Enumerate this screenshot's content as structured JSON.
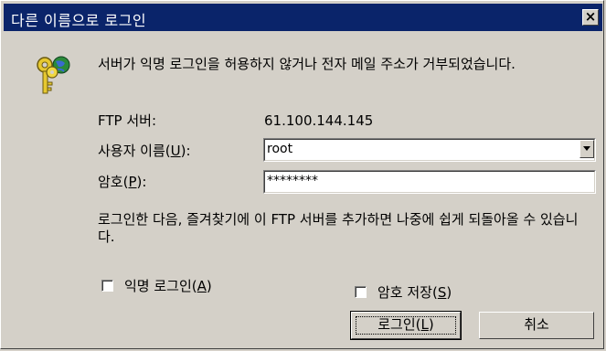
{
  "window": {
    "title": "다른 이름으로 로그인",
    "close_glyph": "×"
  },
  "message": "서버가 익명 로그인을 허용하지 않거나 전자 메일 주소가 거부되었습니다.",
  "ftp_server": {
    "label": "FTP 서버:",
    "value": "61.100.144.145"
  },
  "username": {
    "label_prefix": "사용자 이름(",
    "label_key": "U",
    "label_suffix": "):",
    "value": "root"
  },
  "password": {
    "label_prefix": "암호(",
    "label_key": "P",
    "label_suffix": "):",
    "value": "********"
  },
  "info_text": "로그인한 다음, 즐겨찾기에 이 FTP 서버를 추가하면 나중에 쉽게 되돌아올 수 있습니다.",
  "anonymous_checkbox": {
    "label_prefix": "익명 로그인(",
    "label_key": "A",
    "label_suffix": ")",
    "checked": false
  },
  "save_password_checkbox": {
    "label_prefix": "암호 저장(",
    "label_key": "S",
    "label_suffix": ")",
    "checked": false
  },
  "buttons": {
    "login_prefix": "로그인(",
    "login_key": "L",
    "login_suffix": ")",
    "cancel": "취소"
  },
  "icons": {
    "dialog_icon": "keys-globe-icon",
    "combo_arrow": "chevron-down-icon"
  },
  "colors": {
    "titlebar": "#0a246a",
    "face": "#d4d0c8"
  }
}
